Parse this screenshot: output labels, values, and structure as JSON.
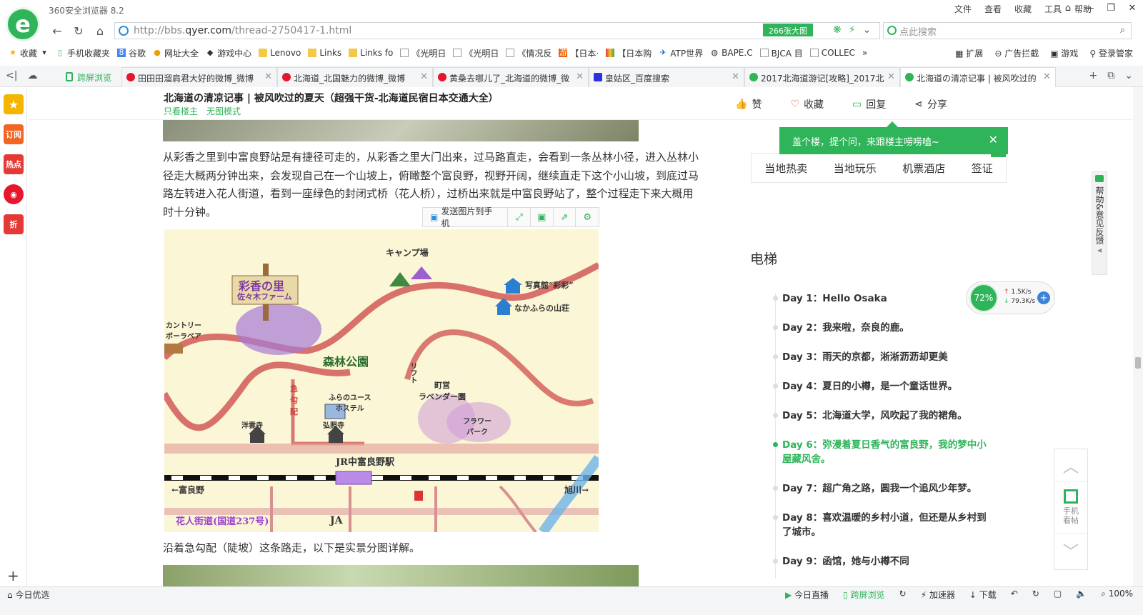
{
  "browser": {
    "title": "360安全浏览器 8.2",
    "logo_letter": "e",
    "menu": [
      "文件",
      "查看",
      "收藏",
      "工具",
      "帮助"
    ],
    "window_controls": [
      "⌂",
      "—",
      "❐",
      "✕"
    ],
    "url_prefix": "http://bbs.",
    "url_domain": "qyer.com",
    "url_path": "/thread-2750417-1.html",
    "image_badge": "266张大图",
    "search_placeholder": "点此搜索",
    "accent_color": "#2fb45a"
  },
  "bookmarks": {
    "items": [
      "收藏",
      "手机收藏夹",
      "谷歌",
      "网址大全",
      "游戏中心",
      "Lenovo",
      "Links",
      "Links fo",
      "《光明日",
      "《光明日",
      "《情况反",
      "【日本·",
      "【日本购",
      "ATP世界",
      "BAPE.C",
      "BJCA 目",
      "COLLEC"
    ],
    "right": [
      "扩展",
      "广告拦截",
      "游戏",
      "登录管家"
    ]
  },
  "tabs": {
    "cross_screen": "跨屏浏览",
    "list": [
      {
        "label": "田田田溜肩君大好的微博_微博"
      },
      {
        "label": "北海道_北国魅力的微博_微博"
      },
      {
        "label": "黄桑去哪儿了_北海道的微博_微"
      },
      {
        "label": "皇姑区_百度搜索"
      },
      {
        "label": "2017北海道游记[攻略]_2017北"
      },
      {
        "label": "北海道の清凉记事 | 被风吹过的"
      }
    ]
  },
  "sidebar": {
    "items": [
      "订阅",
      "热点",
      "折"
    ]
  },
  "post": {
    "title": "北海道の清凉记事 | 被风吹过的夏天（超强干货-北海道民宿日本交通大全）",
    "link_owner": "只看楼主",
    "link_noimage": "无图模式",
    "actions": {
      "like": "赞",
      "favorite": "收藏",
      "reply": "回复",
      "share": "分享"
    },
    "paragraph": "从彩香之里到中富良野站是有捷径可走的，从彩香之里大门出来，过马路直走，会看到一条丛林小径，进入丛林小径走大概两分钟出来，会发现自己在一个山坡上，俯瞰整个富良野，视野开阔，继续直走下这个小山坡，到底过马路左转进入花人街道，看到一座绿色的封闭式桥（花人桥），过桥出来就是中富良野站了，整个过程走下来大概用时十分钟。",
    "image_toolbar": {
      "send": "发送图片到手机"
    },
    "caption": "沿着急勾配（陡坡）这条路走，以下是实景分图详解。"
  },
  "map": {
    "labels": {
      "camp": "キャンプ場",
      "saika1": "彩香の里",
      "saika2": "佐々木ファーム",
      "photo_studio": "写真館“彩彩”",
      "lodge": "なかふらの山荘",
      "country_bear": "カントリー\nボーラベア",
      "forest_park": "森林公園",
      "lift": "リフト",
      "town_lavender": "町営\nラベンダー園",
      "steep": "急\n勾\n配",
      "youth_hostel": "ふらのユース\nホステル",
      "flower_park": "フラワー\nパーク",
      "yojiji": "洋雲寺",
      "koshoji": "弘照寺",
      "station": "JR中富良野駅",
      "furano": "←富良野",
      "asahikawa": "旭川→",
      "hanabito": "花人街道(国道237号)",
      "ja": "JA"
    }
  },
  "right_panel": {
    "tooltip": "盖个楼，提个问，来跟楼主唠唠嗑~",
    "quick_links": [
      "当地热卖",
      "当地玩乐",
      "机票酒店",
      "签证"
    ],
    "elevator_title": "电梯",
    "toc": [
      {
        "label": "Day 1：Hello Osaka",
        "active": false
      },
      {
        "label": "Day 2：我来啦，奈良的鹿。",
        "active": false
      },
      {
        "label": "Day 3：雨天的京都，淅淅沥沥却更美",
        "active": false
      },
      {
        "label": "Day 4：夏日的小樽，是一个童话世界。",
        "active": false
      },
      {
        "label": "Day 5：北海道大学，风吹起了我的裙角。",
        "active": false
      },
      {
        "label": "Day 6：弥漫着夏日香气的富良野，我的梦中小屋藏风舍。",
        "active": true
      },
      {
        "label": "Day 7：超广角之路，圆我一个追风少年梦。",
        "active": false
      },
      {
        "label": "Day 8：喜欢温暖的乡村小道，但还是从乡村到了城市。",
        "active": false
      },
      {
        "label": "Day 9：函馆，她与小樽不同",
        "active": false
      }
    ],
    "feedback": "帮助&意见反馈",
    "mobile": "手机看帖"
  },
  "speed_widget": {
    "percent": "72%",
    "up": "1.5K/s",
    "down": "79.3K/s"
  },
  "status": {
    "left": "今日优选",
    "right": [
      "今日直播",
      "跨屏浏览",
      "加速器",
      "下载",
      "100%"
    ]
  }
}
